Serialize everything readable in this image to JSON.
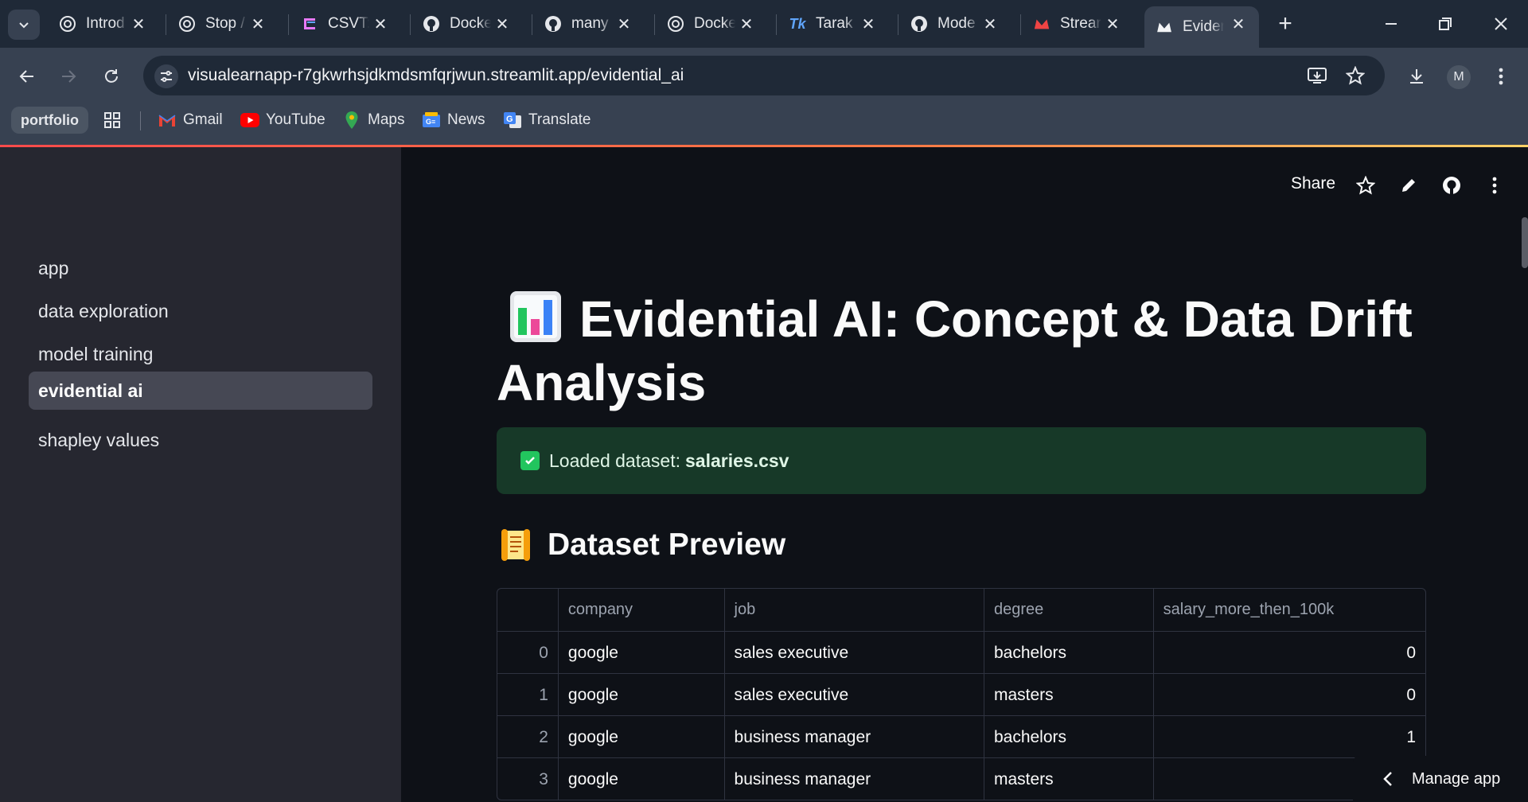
{
  "browser": {
    "tabs": [
      {
        "label": "Introd",
        "icon": "openai-icon"
      },
      {
        "label": "Stop /",
        "icon": "openai-icon"
      },
      {
        "label": "CSVT:",
        "icon": "csvtu-icon"
      },
      {
        "label": "Docke",
        "icon": "github-icon"
      },
      {
        "label": "many",
        "icon": "github-icon"
      },
      {
        "label": "Docke",
        "icon": "openai-icon"
      },
      {
        "label": "Tarak",
        "icon": "tarak-icon"
      },
      {
        "label": "Mode",
        "icon": "github-icon"
      },
      {
        "label": "Strear",
        "icon": "streamlit-icon"
      },
      {
        "label": "Evider",
        "icon": "streamlit-icon",
        "active": true
      }
    ],
    "url": "visualearnapp-r7gkwrhsjdkmdsmfqrjwun.streamlit.app/evidential_ai",
    "avatar_letter": "M",
    "bookmarks": [
      {
        "label": "portfolio"
      },
      {
        "label": "Gmail",
        "icon": "gmail-icon"
      },
      {
        "label": "YouTube",
        "icon": "youtube-icon"
      },
      {
        "label": "Maps",
        "icon": "maps-icon"
      },
      {
        "label": "News",
        "icon": "news-icon"
      },
      {
        "label": "Translate",
        "icon": "translate-icon"
      }
    ]
  },
  "sidebar": {
    "items": [
      {
        "label": "app"
      },
      {
        "label": "data exploration"
      },
      {
        "label": "model training"
      },
      {
        "label": "evidential ai",
        "active": true
      },
      {
        "label": "shapley values"
      }
    ]
  },
  "header": {
    "share_label": "Share"
  },
  "main": {
    "title": "Evidential AI: Concept & Data Drift Analysis",
    "success_prefix": "Loaded dataset:",
    "success_file": "salaries.csv",
    "preview_heading": "Dataset Preview",
    "table": {
      "columns": [
        "",
        "company",
        "job",
        "degree",
        "salary_more_then_100k"
      ],
      "rows": [
        [
          "0",
          "google",
          "sales executive",
          "bachelors",
          "0"
        ],
        [
          "1",
          "google",
          "sales executive",
          "masters",
          "0"
        ],
        [
          "2",
          "google",
          "business manager",
          "bachelors",
          "1"
        ],
        [
          "3",
          "google",
          "business manager",
          "masters",
          ""
        ]
      ]
    }
  },
  "manage_app_label": "Manage app",
  "colors": {
    "accent": "#ff4b4b",
    "success_bg": "#173928",
    "sidebar_bg": "#262730",
    "main_bg": "#0e1117"
  }
}
